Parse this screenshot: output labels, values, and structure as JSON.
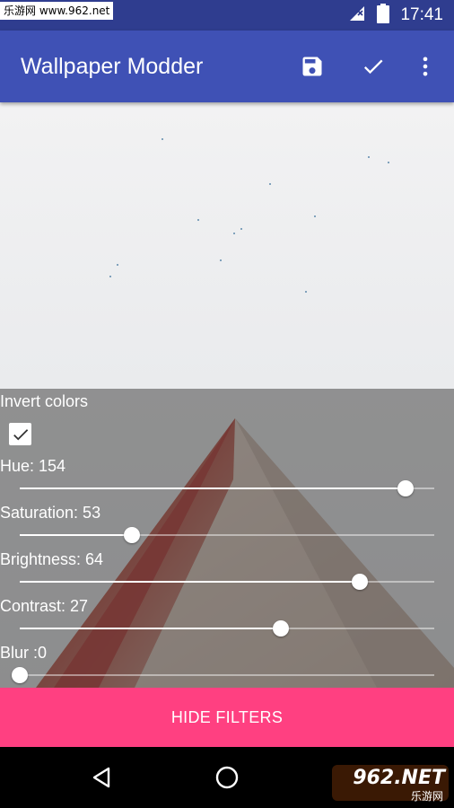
{
  "status_bar": {
    "watermark": "乐游网 www.962.net",
    "time": "17:41",
    "icons": [
      "signal-icon",
      "battery-icon"
    ]
  },
  "app_bar": {
    "title": "Wallpaper Modder",
    "actions": [
      "save-icon",
      "check-icon",
      "more-vert-icon"
    ],
    "color": "#3f51b5"
  },
  "filters": {
    "invert_label": "Invert colors",
    "invert_checked": true,
    "sliders": [
      {
        "label": "Hue: 154",
        "fraction": 0.93
      },
      {
        "label": "Saturation: 53",
        "fraction": 0.27
      },
      {
        "label": "Brightness: 64",
        "fraction": 0.82
      },
      {
        "label": "Contrast: 27",
        "fraction": 0.63
      },
      {
        "label": "Blur :0",
        "fraction": 0.0
      }
    ]
  },
  "bottom_button": {
    "label": "HIDE FILTERS",
    "color": "#ff4081"
  },
  "nav_bar": {
    "buttons": [
      "back-icon",
      "home-icon",
      "recents-icon"
    ],
    "watermark_brand": "962.NET",
    "watermark_sub": "乐游网"
  }
}
